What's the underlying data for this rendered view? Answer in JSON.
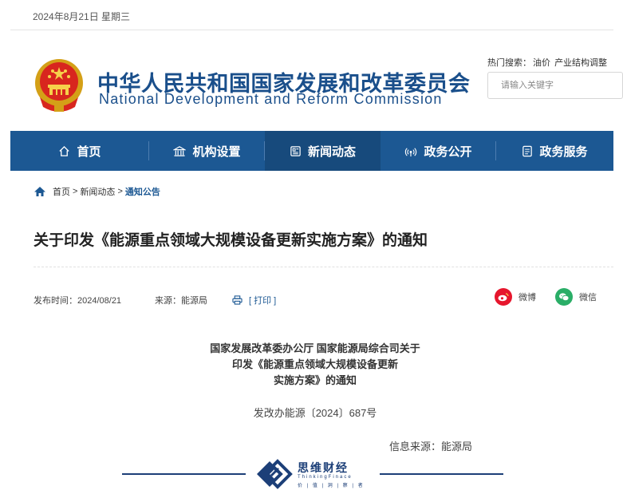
{
  "top": {
    "date": "2024年8月21日 星期三"
  },
  "logo": {
    "cn": "中华人民共和国国家发展和改革委员会",
    "en": "National Development and Reform Commission"
  },
  "search": {
    "hot_label": "热门搜索：",
    "hot_links": [
      "油价",
      "产业结构调整"
    ],
    "placeholder": "请输入关键字"
  },
  "nav": {
    "items": [
      {
        "label": "首页",
        "icon": "home-icon"
      },
      {
        "label": "机构设置",
        "icon": "institution-icon"
      },
      {
        "label": "新闻动态",
        "icon": "news-icon",
        "active": true
      },
      {
        "label": "政务公开",
        "icon": "broadcast-icon"
      },
      {
        "label": "政务服务",
        "icon": "document-icon"
      }
    ],
    "color": "#1c5893",
    "active_color": "#174a7c"
  },
  "breadcrumb": {
    "items": [
      "首页",
      "新闻动态",
      "通知公告"
    ],
    "separator": ">"
  },
  "article": {
    "title": "关于印发《能源重点领域大规模设备更新实施方案》的通知",
    "publish_label": "发布时间：",
    "publish_date": "2024/08/21",
    "source_label": "来源：",
    "source": "能源局",
    "print_label": "[ 打印 ]",
    "share": [
      {
        "label": "微博",
        "icon": "weibo-icon",
        "color": "#e6162d"
      },
      {
        "label": "微信",
        "icon": "wechat-icon",
        "color": "#2aae67"
      }
    ],
    "heading_lines": [
      "国家发展改革委办公厅 国家能源局综合司关于",
      "印发《能源重点领域大规模设备更新",
      "实施方案》的通知"
    ],
    "doc_number": "发改办能源〔2024〕687号",
    "info_source": "信息来源：能源局"
  },
  "watermark": {
    "cn": "思维财经",
    "en": "ThinkingFinace",
    "sub": "价 | 值 | 洞 | 察 | 者",
    "color": "#1c3f78"
  }
}
